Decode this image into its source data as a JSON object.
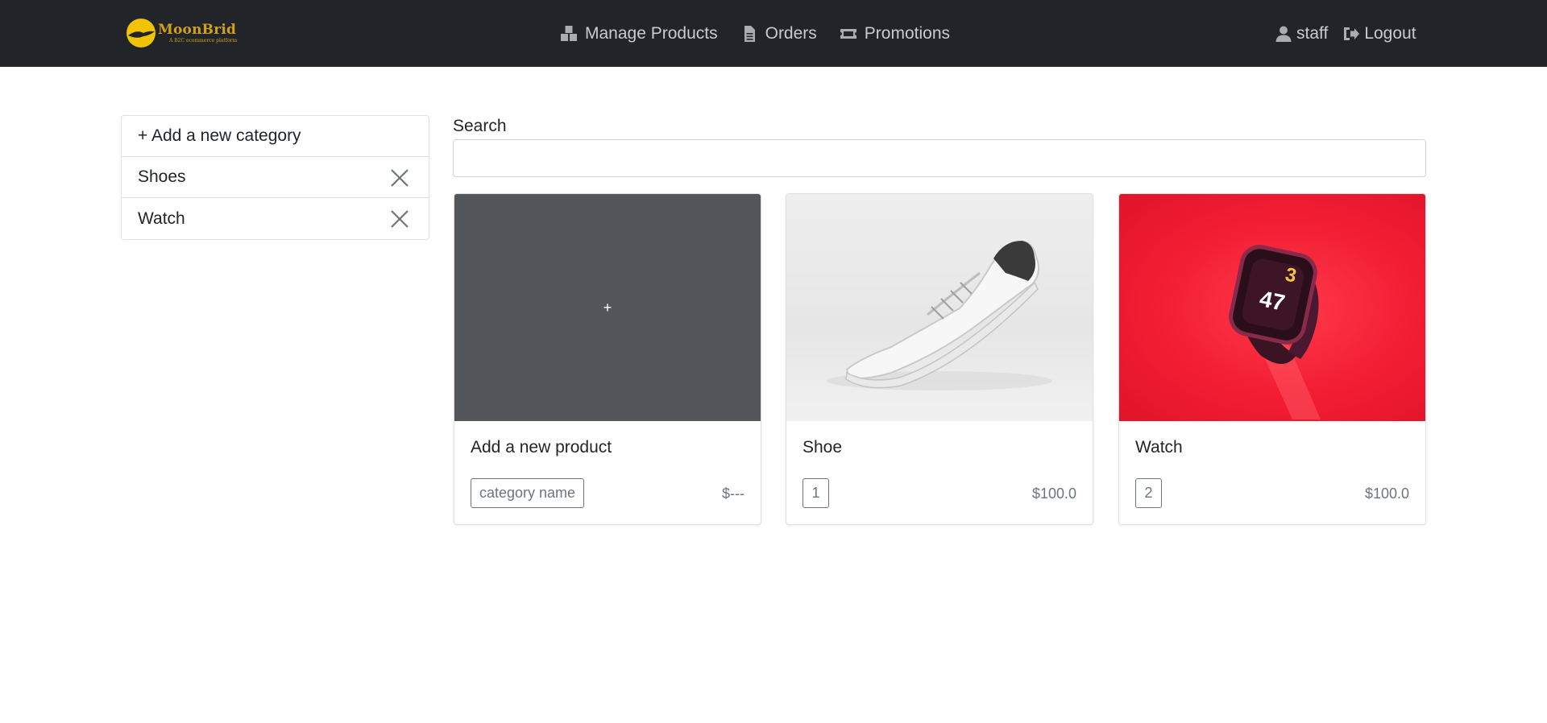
{
  "brand": {
    "name": "MoonBrid",
    "tagline": "A B2C ecommerce platform"
  },
  "nav": {
    "links": [
      {
        "label": "Manage Products",
        "icon": "boxes-icon"
      },
      {
        "label": "Orders",
        "icon": "file-icon"
      },
      {
        "label": "Promotions",
        "icon": "ticket-icon"
      }
    ],
    "user": {
      "label": "staff",
      "icon": "user-icon"
    },
    "logout": {
      "label": "Logout",
      "icon": "sign-out-icon"
    }
  },
  "sidebar": {
    "add_label": "+ Add a new category",
    "categories": [
      {
        "label": "Shoes"
      },
      {
        "label": "Watch"
      }
    ]
  },
  "search": {
    "label": "Search",
    "value": "",
    "placeholder": ""
  },
  "products": [
    {
      "title": "Add a new product",
      "category": "category name",
      "price": "$---",
      "image_text": "+"
    },
    {
      "title": "Shoe",
      "category": "1",
      "price": "$100.0"
    },
    {
      "title": "Watch",
      "category": "2",
      "price": "$100.0"
    }
  ],
  "colors": {
    "navbar": "#212529",
    "brand": "#d4a017",
    "placeholder_card": "#53575b",
    "watch_bg": "#f21d33"
  }
}
